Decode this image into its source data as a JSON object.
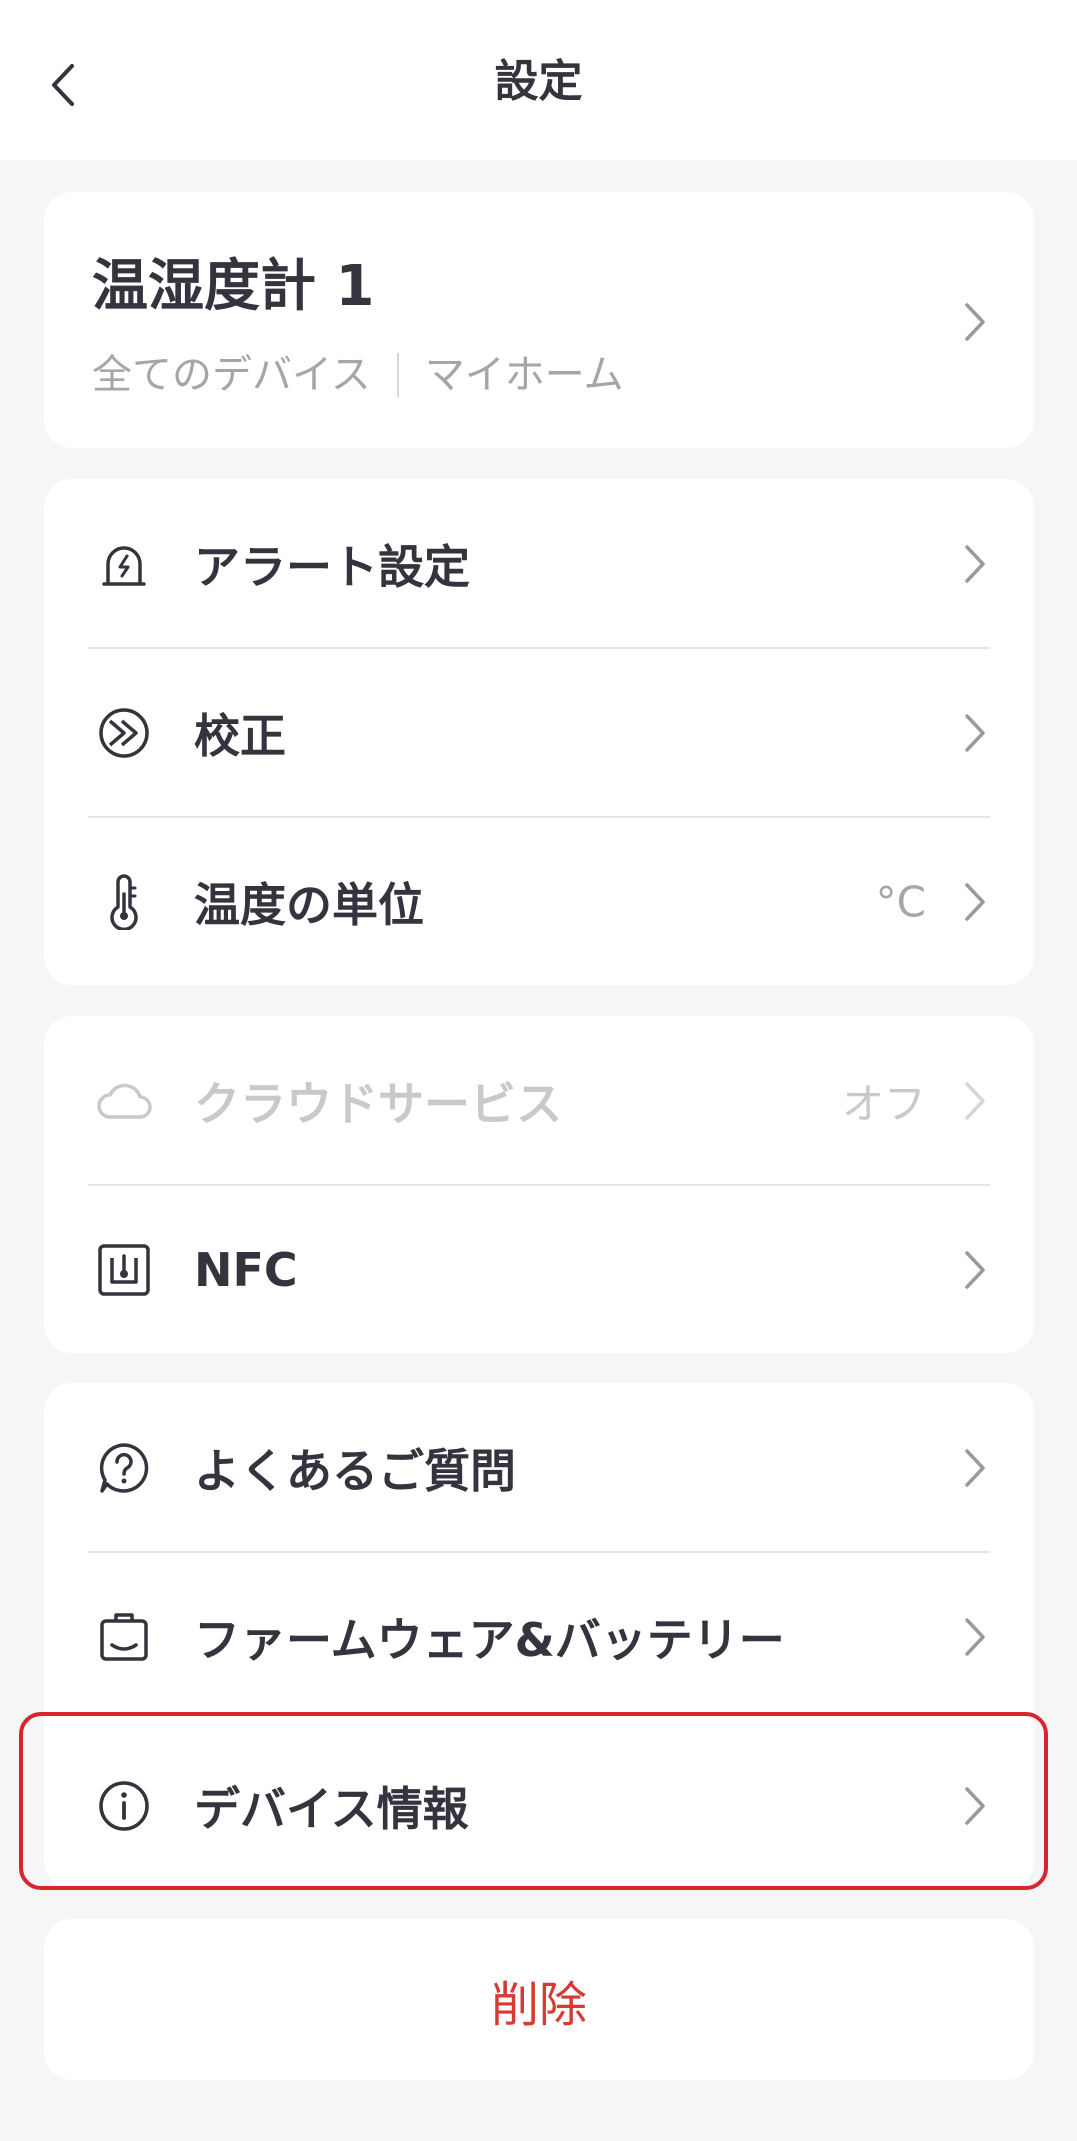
{
  "header": {
    "title": "設定"
  },
  "device": {
    "name": "温湿度計 1",
    "group": "全てのデバイス",
    "home": "マイホーム"
  },
  "settings": {
    "alert": {
      "label": "アラート設定"
    },
    "calibration": {
      "label": "校正"
    },
    "temp_unit": {
      "label": "温度の単位",
      "value": "°C"
    }
  },
  "services": {
    "cloud": {
      "label": "クラウドサービス",
      "value": "オフ"
    },
    "nfc": {
      "label": "NFC"
    }
  },
  "support": {
    "faq": {
      "label": "よくあるご質問"
    },
    "firmware": {
      "label": "ファームウェア&バッテリー"
    },
    "device_info": {
      "label": "デバイス情報"
    }
  },
  "actions": {
    "delete_label": "削除"
  },
  "colors": {
    "background": "#f6f6f6",
    "card": "#ffffff",
    "text": "#33343d",
    "secondary": "#a6a6a6",
    "disabled": "#c9c9c9",
    "danger": "#d83a33",
    "highlight_border": "#d9262c"
  },
  "icons": [
    "back-icon",
    "chevron-right-icon",
    "alarm-bell-icon",
    "calibration-icon",
    "thermometer-icon",
    "cloud-icon",
    "nfc-icon",
    "help-icon",
    "firmware-icon",
    "info-icon"
  ]
}
